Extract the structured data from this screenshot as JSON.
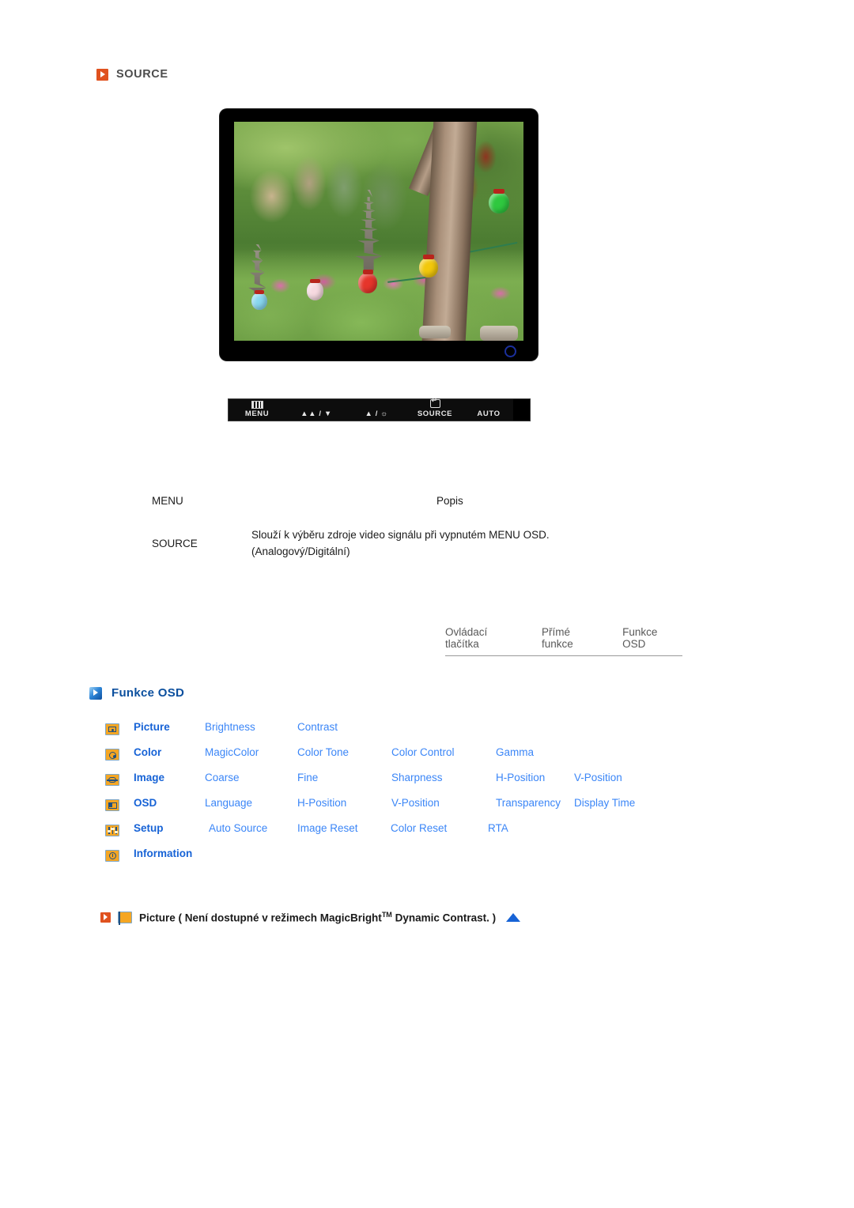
{
  "source_section": {
    "heading": "SOURCE",
    "icon": "orange-play-icon"
  },
  "monitor": {
    "alt": "lcd-monitor-photo",
    "logo": "samsung-circle-logo"
  },
  "control_bar": {
    "buttons": [
      {
        "label": "MENU",
        "icon": "menu-bars-icon"
      },
      {
        "label": "▲▲ / ▼",
        "icon": "brightness-down-icon"
      },
      {
        "label": "▲ / ☼",
        "icon": "brightness-up-icon"
      },
      {
        "label": "SOURCE",
        "icon": "enter-icon"
      },
      {
        "label": "AUTO",
        "icon": "auto-icon"
      },
      {
        "label": "",
        "icon": "power-icon"
      }
    ]
  },
  "description_table": {
    "headers": {
      "menu": "MENU",
      "popis": "Popis"
    },
    "rows": [
      {
        "menu": "SOURCE",
        "popis_line1": "Slouží k výběru zdroje video signálu při vypnutém MENU OSD.",
        "popis_line2": "(Analogový/Digitální)"
      }
    ]
  },
  "subnav": {
    "items": [
      "Ovládací tlačítka",
      "Přímé funkce",
      "Funkce OSD"
    ]
  },
  "osd_section": {
    "heading": "Funkce OSD",
    "icon": "blue-play-icon",
    "rows": [
      {
        "icon": "picture-icon",
        "category": "Picture",
        "items": [
          "Brightness",
          "Contrast"
        ]
      },
      {
        "icon": "color-icon",
        "category": "Color",
        "items": [
          "MagicColor",
          "Color Tone",
          "Color Control",
          "Gamma"
        ]
      },
      {
        "icon": "image-icon",
        "category": "Image",
        "items": [
          "Coarse",
          "Fine",
          "Sharpness",
          "H-Position",
          "V-Position"
        ]
      },
      {
        "icon": "osd-icon",
        "category": "OSD",
        "items": [
          "Language",
          "H-Position",
          "V-Position",
          "Transparency",
          "Display Time"
        ]
      },
      {
        "icon": "setup-icon",
        "category": "Setup",
        "items": [
          "Auto Source",
          "Image Reset",
          "Color Reset",
          "RTA"
        ]
      },
      {
        "icon": "information-icon",
        "category": "Information",
        "items": []
      }
    ]
  },
  "footnote": {
    "bullet_icon": "orange-play-icon",
    "category_icon": "picture-icon",
    "text_before": "Picture ( Není dostupné v režimech MagicBright",
    "superscript": "TM",
    "text_after": " Dynamic Contrast. )",
    "scroll_icon": "up-triangle-icon"
  },
  "colors": {
    "orange_accent": "#e0521f",
    "blue_heading": "#0b4f9e",
    "link_blue": "#3b86f7",
    "category_blue": "#1763d6",
    "icon_orange": "#f5a623",
    "text_gray": "#4d4d4d"
  }
}
